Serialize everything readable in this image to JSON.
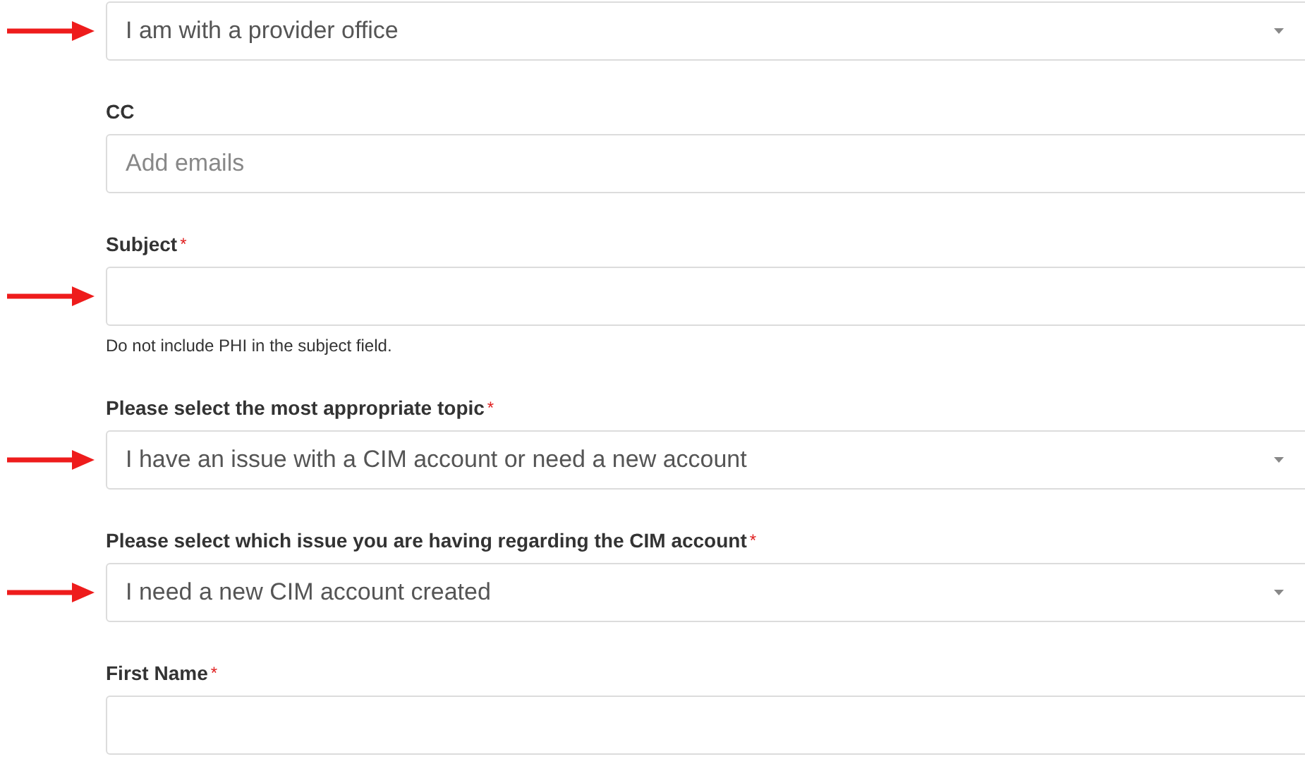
{
  "fields": [
    {
      "kind": "select",
      "marked": true,
      "value": "I am with a provider office"
    },
    {
      "kind": "input",
      "label": "CC",
      "placeholder": "Add emails"
    },
    {
      "kind": "input",
      "label": "Subject",
      "required_mark": "*",
      "marked": true,
      "hint": "Do not include PHI in the subject field."
    },
    {
      "kind": "select",
      "label": "Please select the most appropriate topic",
      "required_mark": "*",
      "marked": true,
      "value": "I have an issue with a CIM account or need a new account"
    },
    {
      "kind": "select",
      "label": "Please select which issue you are having regarding the CIM account",
      "required_mark": "*",
      "marked": true,
      "value": "I need a new CIM account created"
    },
    {
      "kind": "input",
      "label": "First Name",
      "required_mark": "*"
    }
  ]
}
